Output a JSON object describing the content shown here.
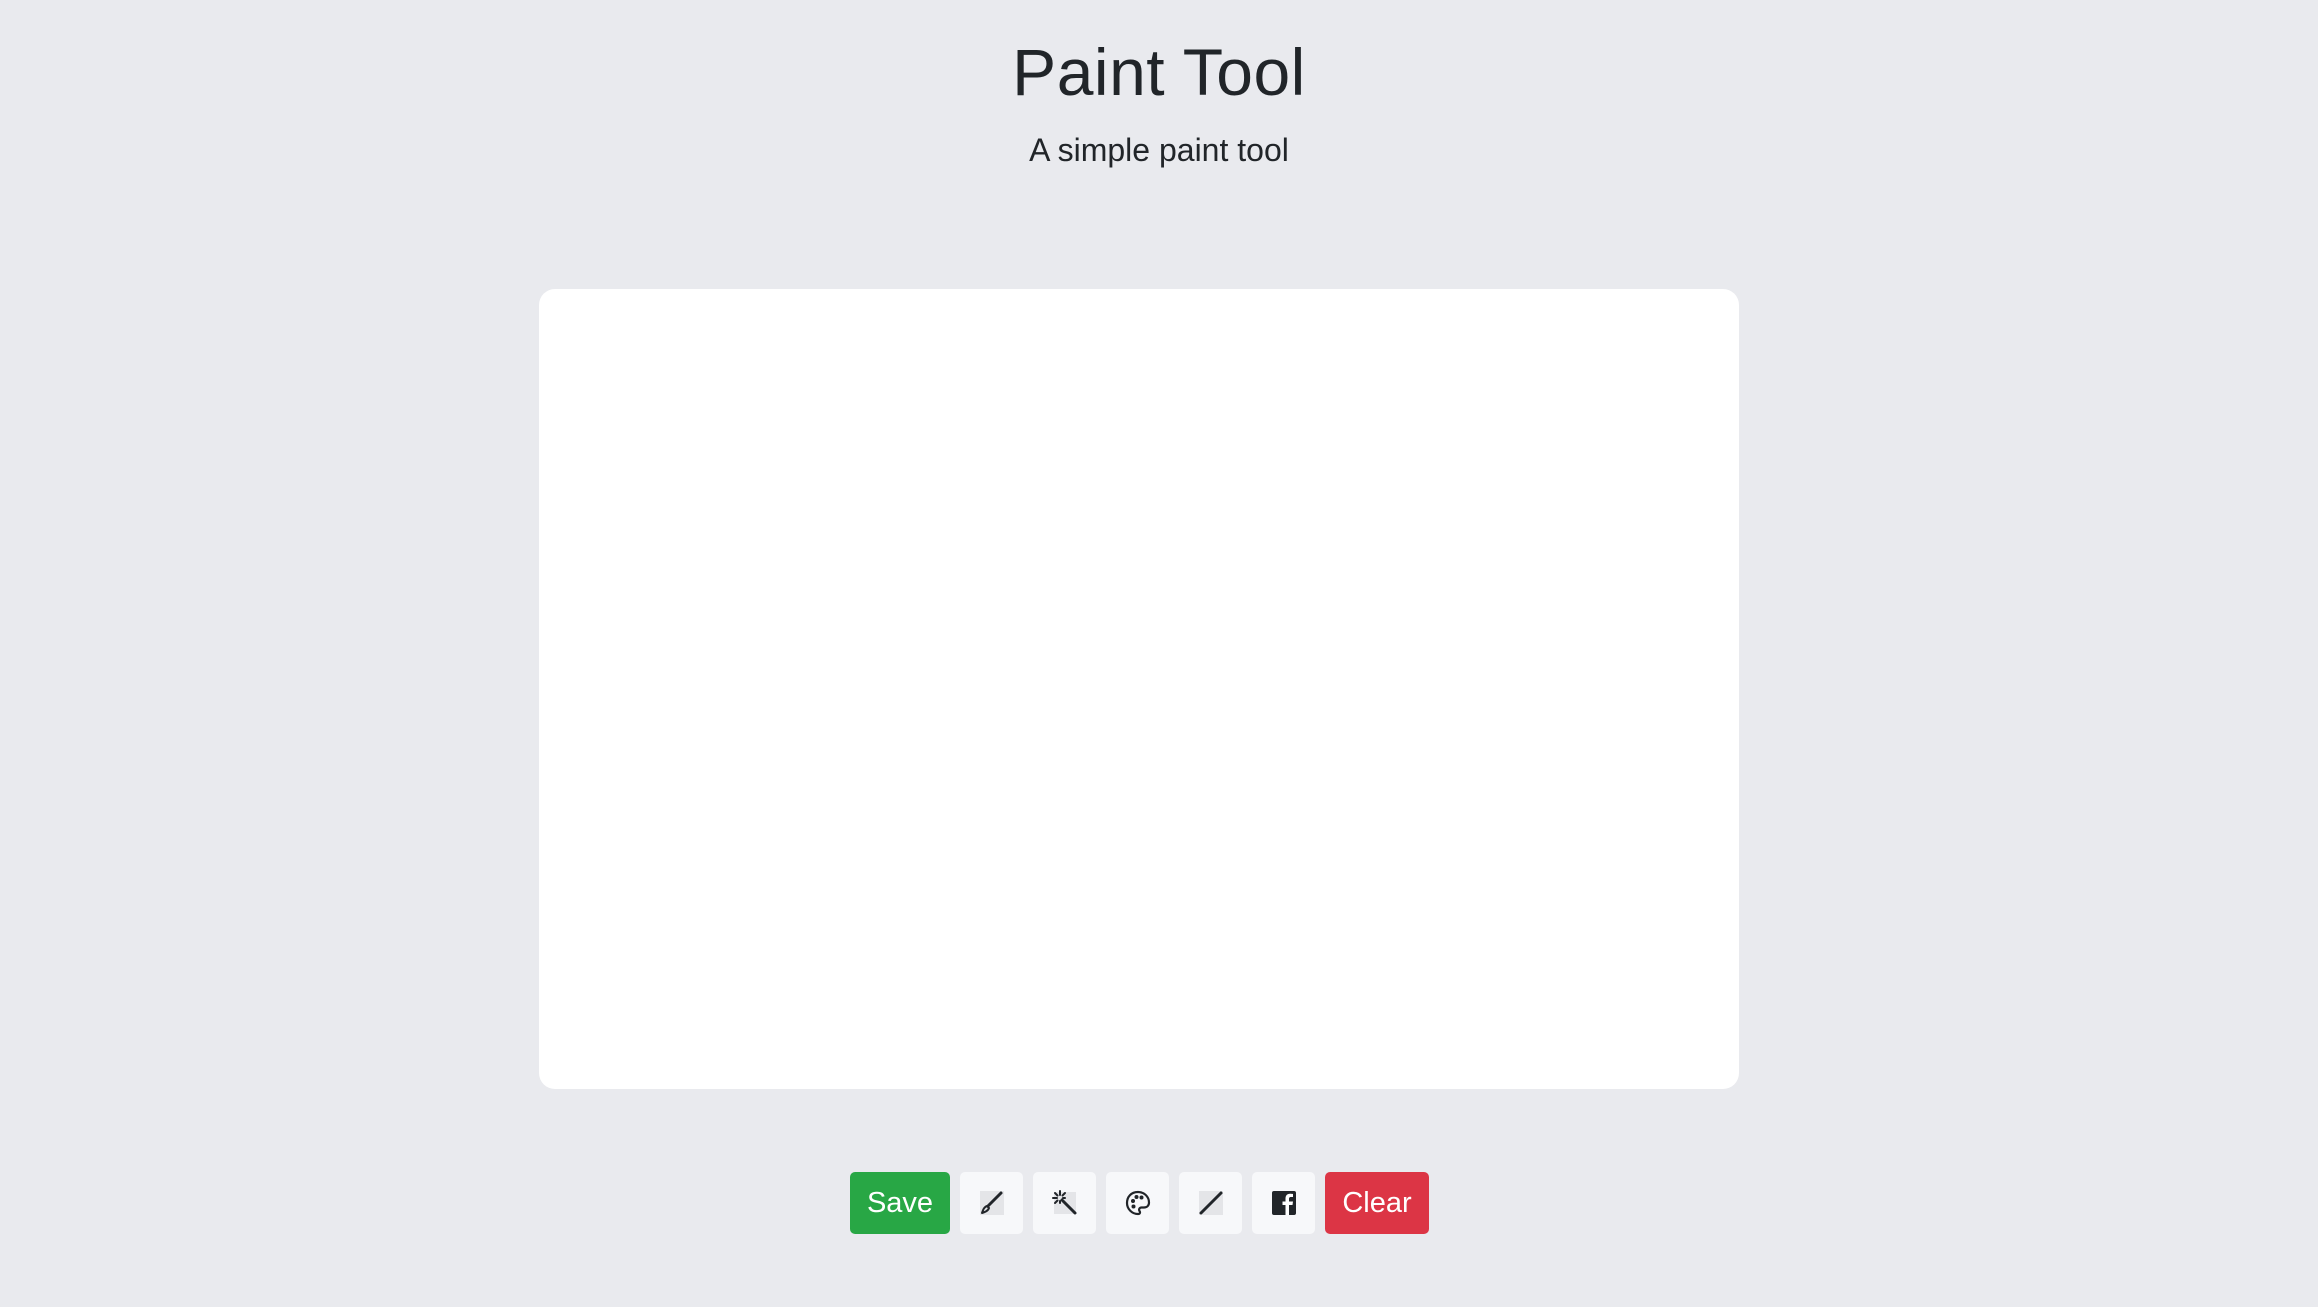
{
  "header": {
    "title": "Paint Tool",
    "subtitle": "A simple paint tool"
  },
  "canvas": {
    "background": "#ffffff"
  },
  "toolbar": {
    "save_label": "Save",
    "clear_label": "Clear",
    "tools": [
      {
        "icon": "paintbrush-icon"
      },
      {
        "icon": "magic-wand-icon"
      },
      {
        "icon": "palette-icon"
      },
      {
        "icon": "pencil-line-icon"
      },
      {
        "icon": "facebook-icon"
      }
    ]
  },
  "colors": {
    "background": "#e9eaee",
    "save": "#28a745",
    "clear": "#dc3545",
    "tool_button": "#f7f8fa"
  }
}
